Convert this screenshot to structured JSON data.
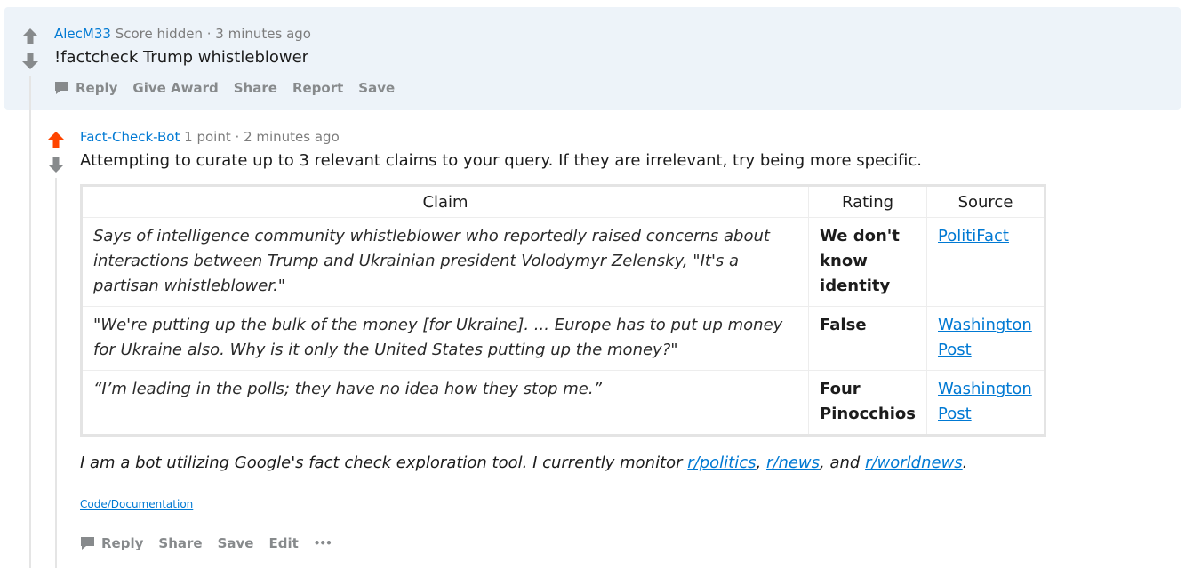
{
  "parent_comment": {
    "author": "AlecM33",
    "score": "Score hidden",
    "separator": "·",
    "time": "3 minutes ago",
    "text": "!factcheck Trump whistleblower",
    "actions": {
      "reply": "Reply",
      "give_award": "Give Award",
      "share": "Share",
      "report": "Report",
      "save": "Save"
    }
  },
  "bot_comment": {
    "author": "Fact-Check-Bot",
    "score": "1 point",
    "separator": "·",
    "time": "2 minutes ago",
    "intro": "Attempting to curate up to 3 relevant claims to your query. If they are irrelevant, try being more specific.",
    "table": {
      "headers": [
        "Claim",
        "Rating",
        "Source"
      ],
      "rows": [
        {
          "claim": "Says of intelligence community whistleblower who reportedly raised concerns about interactions between Trump and Ukrainian president Volodymyr Zelensky, \"It's a partisan whistleblower.\"",
          "rating": "We don't know identity",
          "source": "PolitiFact"
        },
        {
          "claim": "\"We're putting up the bulk of the money [for Ukraine]. ... Europe has to put up money for Ukraine also. Why is it only the United States putting up the money?\"",
          "rating": "False",
          "source": "Washington Post"
        },
        {
          "claim": "“I’m leading in the polls; they have no idea how they stop me.”",
          "rating": "Four Pinocchios",
          "source": "Washington Post"
        }
      ]
    },
    "footer": {
      "prefix": "I am a bot utilizing Google's fact check exploration tool. I currently monitor ",
      "link1": "r/politics",
      "sep1": ", ",
      "link2": "r/news",
      "sep2": ", and ",
      "link3": "r/worldnews",
      "suffix": "."
    },
    "code_link": "Code/Documentation",
    "actions": {
      "reply": "Reply",
      "share": "Share",
      "save": "Save",
      "edit": "Edit",
      "more": "•••"
    }
  },
  "icons": {
    "upvote": "upvote-arrow-icon",
    "downvote": "downvote-arrow-icon",
    "reply": "comment-bubble-icon"
  },
  "colors": {
    "upvoted": "#ff4500",
    "arrow_neutral": "#878a8c",
    "link": "#0079d3",
    "highlight_bg": "#edf3f9"
  }
}
